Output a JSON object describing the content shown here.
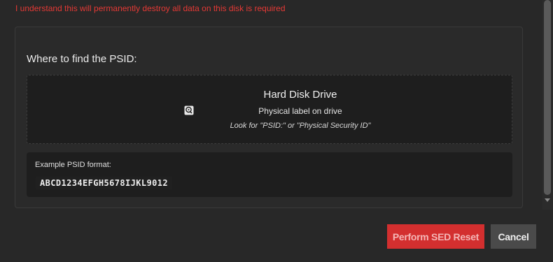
{
  "form": {
    "confirm_error": "I understand this will permanently destroy all data on this disk is required"
  },
  "psid_panel": {
    "title": "Where to find the PSID:",
    "drive": {
      "icon": "hard-disk-icon",
      "title": "Hard Disk Drive",
      "label": "Physical label on drive",
      "hint": "Look for \"PSID:\" or \"Physical Security ID\""
    },
    "example": {
      "label": "Example PSID format:",
      "value": "ABCD1234EFGH5678IJKL9012"
    }
  },
  "actions": {
    "reset_label": "Perform SED Reset",
    "cancel_label": "Cancel"
  },
  "colors": {
    "error": "#e53935",
    "danger_button": "#d32f2f",
    "secondary_button": "#4a4a4a",
    "background": "#282828"
  }
}
